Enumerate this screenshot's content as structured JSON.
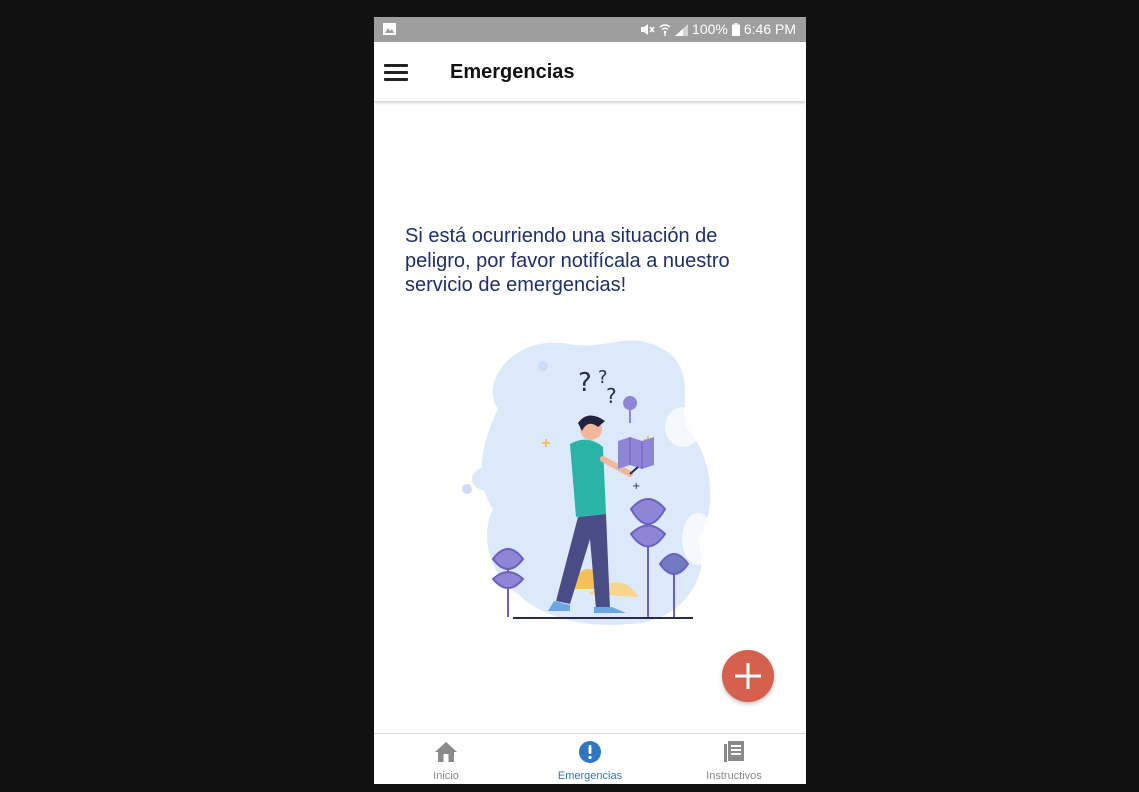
{
  "status_bar": {
    "battery_text": "100%",
    "time": "6:46 PM",
    "icons": [
      "image-icon",
      "mute-icon",
      "wifi-icon",
      "signal-icon",
      "battery-icon"
    ]
  },
  "app_bar": {
    "title": "Emergencias",
    "menu_icon": "hamburger-menu-icon"
  },
  "main": {
    "message": "Si está ocurriendo una situación de peligro, por favor notifícala a nuestro servicio de emergencias!",
    "illustration": "person-with-map-illustration"
  },
  "fab": {
    "icon": "plus-icon",
    "color": "#d6604e"
  },
  "bottom_nav": {
    "items": [
      {
        "label": "Inicio",
        "icon": "home-icon",
        "active": false
      },
      {
        "label": "Emergencias",
        "icon": "alert-icon",
        "active": true
      },
      {
        "label": "Instructivos",
        "icon": "document-icon",
        "active": false
      }
    ]
  },
  "colors": {
    "status_bar": "#9e9e9e",
    "message_text": "#1e2f6b",
    "active_nav": "#2f77c2",
    "inactive_nav": "#8a8a8a",
    "illustration_bg": "#dce9fb"
  }
}
